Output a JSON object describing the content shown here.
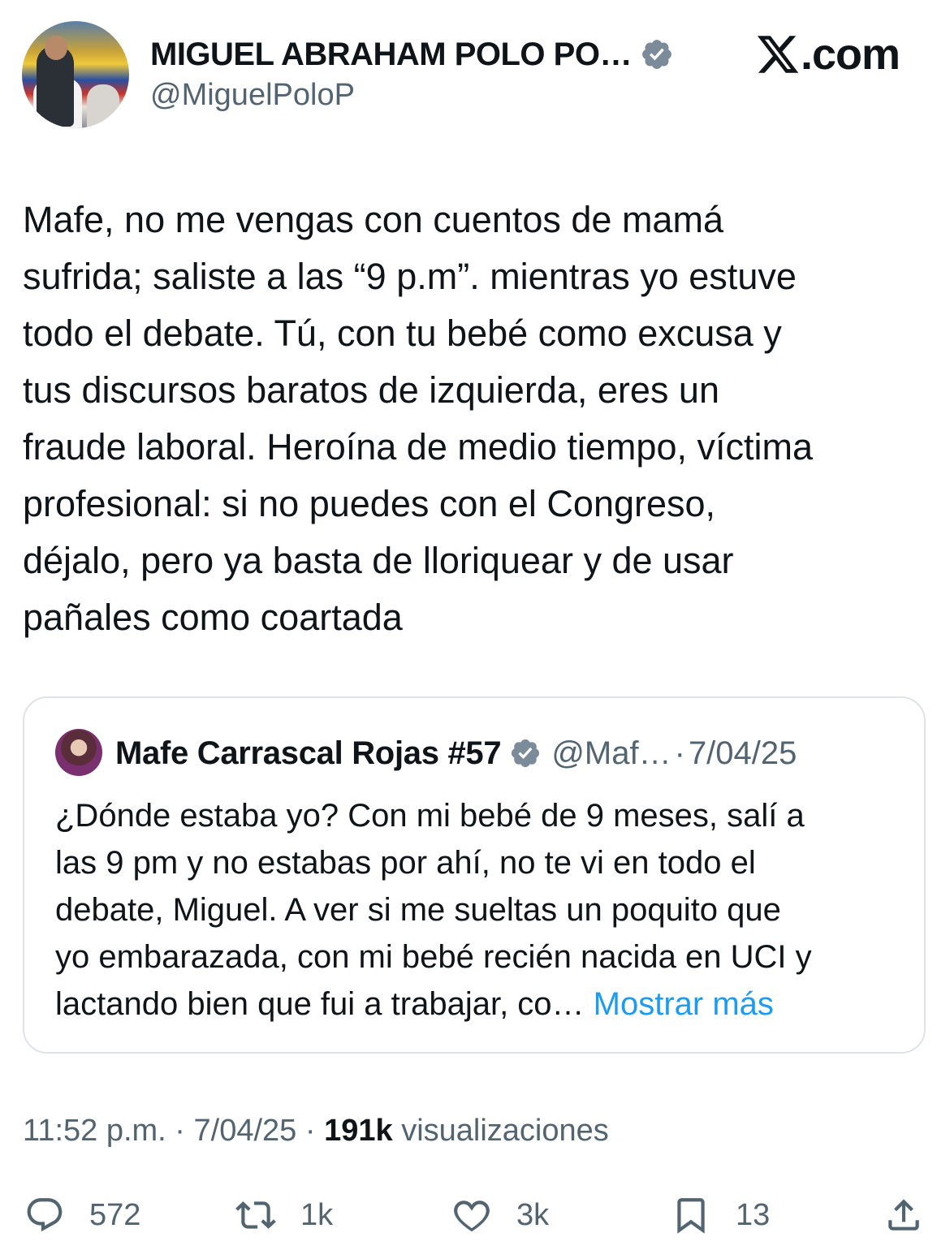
{
  "author": {
    "name": "MIGUEL ABRAHAM POLO PO…",
    "handle": "@MiguelPoloP"
  },
  "brand": {
    "site": ".com"
  },
  "tweet": {
    "text": "Mafe, no me vengas con cuentos de mamá\nsufrida; saliste a las “9 p.m”. mientras yo estuve\ntodo el debate. Tú, con tu bebé como excusa y\ntus discursos baratos de izquierda, eres un\nfraude laboral. Heroína de medio tiempo, víctima\nprofesional: si no puedes con el Congreso,\ndéjalo, pero ya basta de lloriquear y de usar\npañales como coartada"
  },
  "quote": {
    "name": "Mafe Carrascal Rojas #57",
    "handle": "@Maf…",
    "separator": "·",
    "date": "7/04/25",
    "text": "¿Dónde estaba yo? Con mi bebé de 9 meses, salí a\nlas 9 pm y no estabas por ahí, no te vi en todo el\ndebate, Miguel. A ver si me sueltas un poquito que\nyo embarazada, con mi bebé recién nacida en UCI y\nlactando bien que fui a trabajar, co…",
    "show_more": "Mostrar más"
  },
  "meta": {
    "time": "11:52 p.m.",
    "dot1": " · ",
    "date": "7/04/25",
    "dot2": " · ",
    "views_count": "191k",
    "views_label": " visualizaciones"
  },
  "actions": {
    "replies": "572",
    "reposts": "1k",
    "likes": "3k",
    "bookmarks": "13"
  },
  "colors": {
    "text": "#0f1419",
    "secondary": "#536471",
    "link": "#1d9bf0",
    "verified_badge": "#7b8b9a"
  },
  "icons": [
    "verified-icon",
    "x-logo-icon",
    "reply-icon",
    "repost-icon",
    "like-icon",
    "bookmark-icon",
    "share-icon"
  ]
}
